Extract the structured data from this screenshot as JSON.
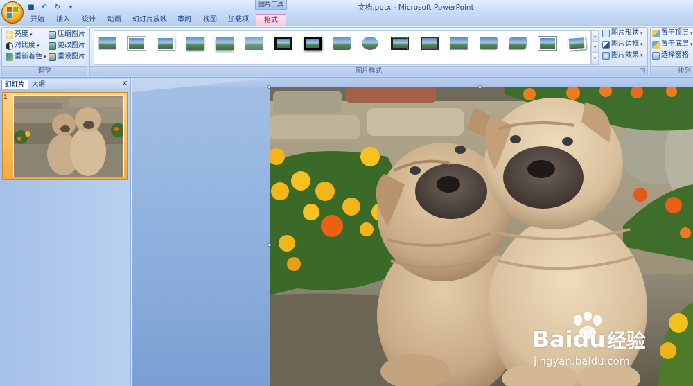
{
  "window": {
    "title": "文档.pptx - Microsoft PowerPoint",
    "contextual_tab_group": "图片工具"
  },
  "quick_access": [
    {
      "name": "save-icon",
      "glyph": "■"
    },
    {
      "name": "undo-icon",
      "glyph": "↶"
    },
    {
      "name": "redo-icon",
      "glyph": "↻"
    },
    {
      "name": "customize-qat-icon",
      "glyph": "▾"
    }
  ],
  "tabs": [
    {
      "label": "开始"
    },
    {
      "label": "插入"
    },
    {
      "label": "设计"
    },
    {
      "label": "动画"
    },
    {
      "label": "幻灯片放映"
    },
    {
      "label": "审阅"
    },
    {
      "label": "视图"
    },
    {
      "label": "加载项"
    },
    {
      "label": "格式",
      "active": true
    }
  ],
  "ribbon": {
    "adjust": {
      "label": "调整",
      "brightness": "亮度",
      "contrast": "对比度",
      "recolor": "重新着色",
      "compress": "压缩图片",
      "change_picture": "更改图片",
      "reset_picture": "重设图片"
    },
    "picture_styles": {
      "label": "图片样式",
      "shape": "图片形状",
      "border": "图片边框",
      "effects": "图片效果"
    },
    "arrange": {
      "label": "排列",
      "bring_front": "置于顶层",
      "send_back": "置于底层",
      "selection_pane": "选择窗格"
    }
  },
  "panel": {
    "tab_slides": "幻灯片",
    "tab_outline": "大纲",
    "slide_number": "1"
  },
  "colors": {
    "accent_contextual": "#d68ab4",
    "ribbon_text": "#15428b",
    "selected_slide": "#f3a83b"
  },
  "watermark": {
    "brand": "Bai",
    "brand_suffix": "du",
    "brand_cn": "经验",
    "url": "jingyan.baidu.com"
  }
}
